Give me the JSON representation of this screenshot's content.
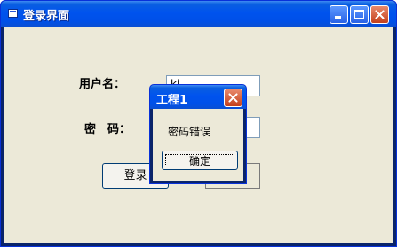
{
  "window": {
    "title": "登录界面"
  },
  "form": {
    "username_label": "用户名：",
    "username_value": "ki",
    "password_label": "密　码：",
    "password_value": "",
    "login_label": "登录",
    "cancel_label": ""
  },
  "dialog": {
    "title": "工程1",
    "message": "密码错误",
    "ok_label": "确定"
  },
  "icons": [
    "app-icon",
    "minimize-icon",
    "maximize-icon",
    "close-icon",
    "dialog-close-icon"
  ],
  "colors": {
    "titlebar": "#0053ee",
    "client": "#ece9d8",
    "close": "#c4401c"
  }
}
